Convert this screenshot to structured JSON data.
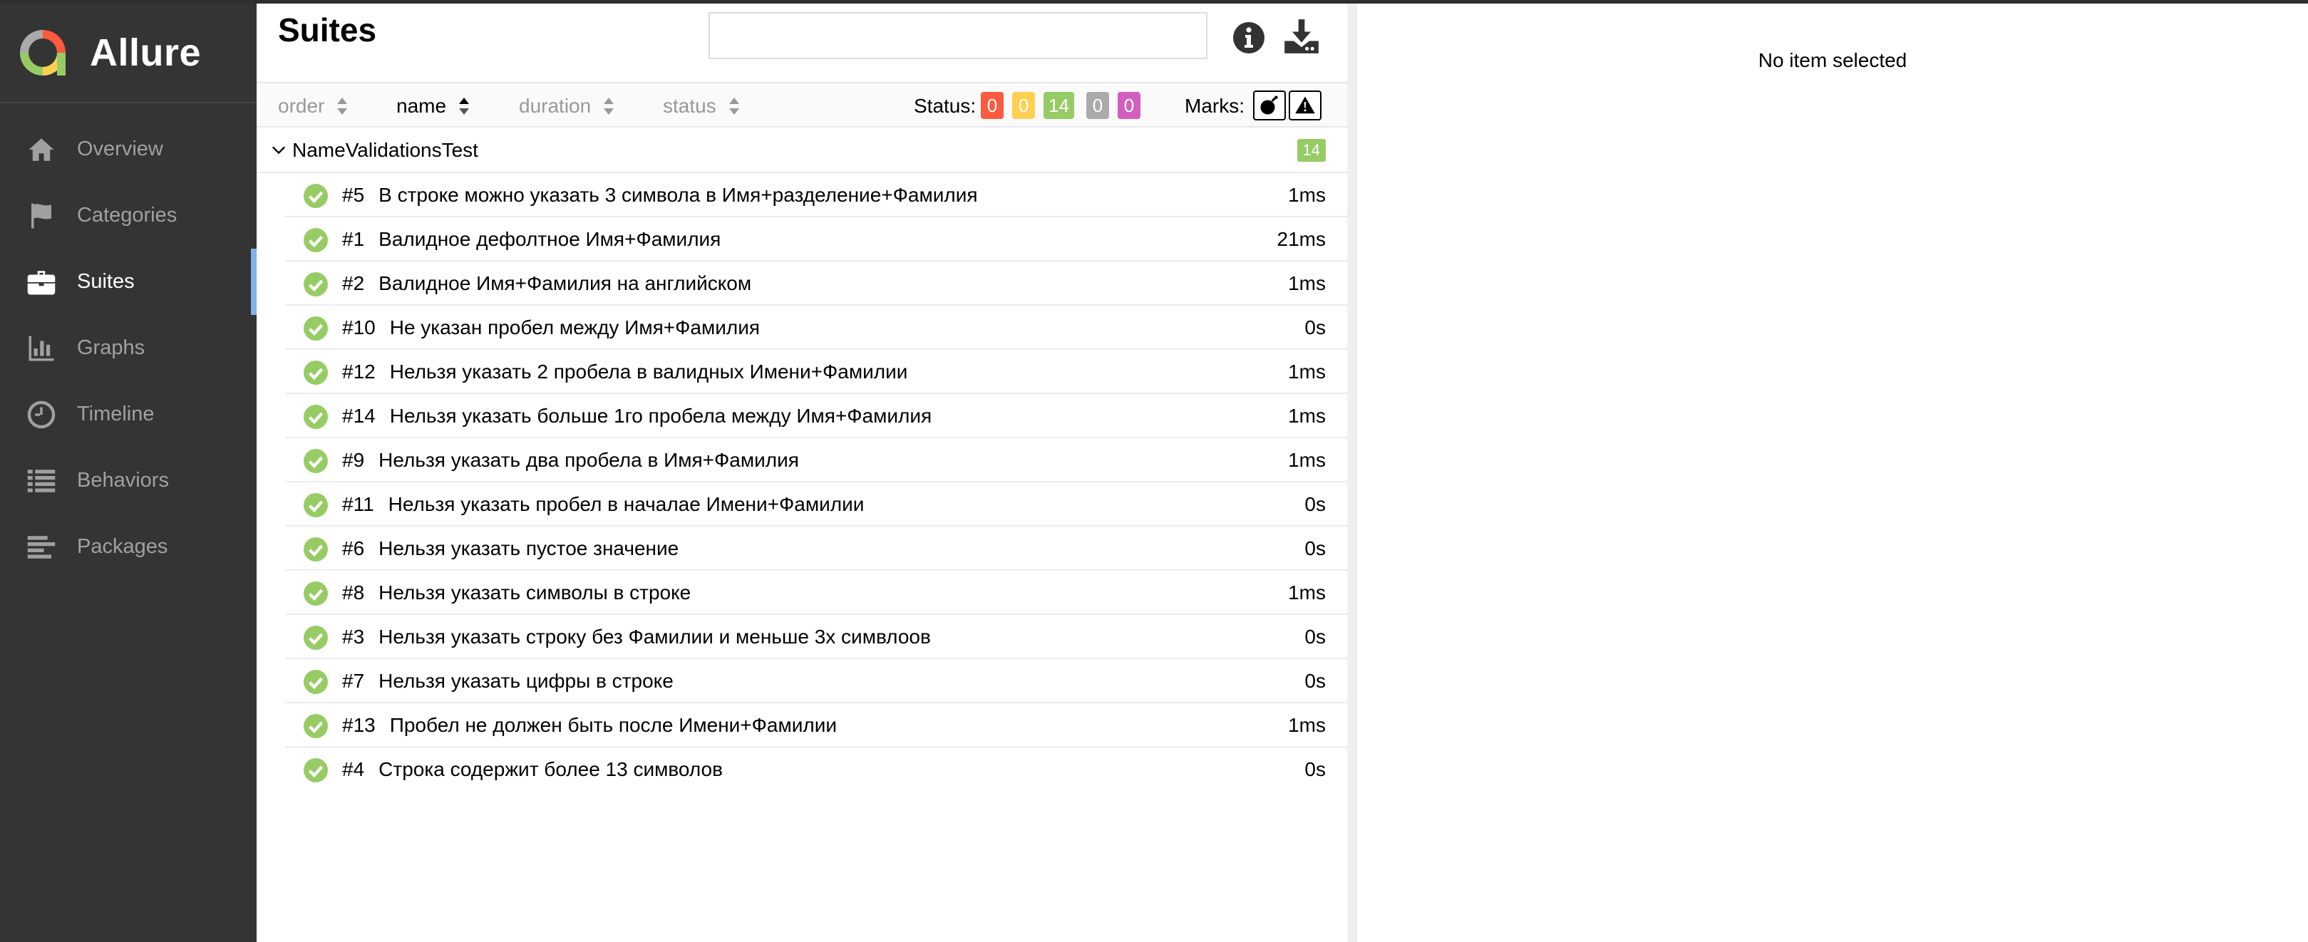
{
  "app": {
    "name": "Allure"
  },
  "sidebar": {
    "items": [
      {
        "label": "Overview",
        "icon": "home-icon"
      },
      {
        "label": "Categories",
        "icon": "flag-icon"
      },
      {
        "label": "Suites",
        "icon": "briefcase-icon",
        "active": true
      },
      {
        "label": "Graphs",
        "icon": "bar-chart-icon"
      },
      {
        "label": "Timeline",
        "icon": "clock-icon"
      },
      {
        "label": "Behaviors",
        "icon": "list-icon"
      },
      {
        "label": "Packages",
        "icon": "align-left-icon"
      }
    ]
  },
  "main": {
    "title": "Suites",
    "search": {
      "value": "",
      "placeholder": ""
    },
    "sorters": {
      "order": "order",
      "name": "name",
      "duration": "duration",
      "status": "status"
    },
    "status_label": "Status:",
    "status_counts": {
      "failed": "0",
      "broken": "0",
      "passed": "14",
      "skipped": "0",
      "unknown": "0"
    },
    "status_colors": {
      "failed": "#fd5a3e",
      "broken": "#ffd050",
      "passed": "#97cc64",
      "skipped": "#aaaaaa",
      "unknown": "#d35ebe"
    },
    "marks_label": "Marks:",
    "group": {
      "name": "NameValidationsTest",
      "count": "14"
    },
    "tests": [
      {
        "num": "#5",
        "name": "В строке можно указать 3 символа в Имя+разделение+Фамилия",
        "duration": "1ms"
      },
      {
        "num": "#1",
        "name": "Валидное дефолтное Имя+Фамилия",
        "duration": "21ms"
      },
      {
        "num": "#2",
        "name": "Валидное Имя+Фамилия на английском",
        "duration": "1ms"
      },
      {
        "num": "#10",
        "name": "Не указан пробел между Имя+Фамилия",
        "duration": "0s"
      },
      {
        "num": "#12",
        "name": "Нельзя указать 2 пробела в валидных Имени+Фамилии",
        "duration": "1ms"
      },
      {
        "num": "#14",
        "name": "Нельзя указать больше 1го пробела между Имя+Фамилия",
        "duration": "1ms"
      },
      {
        "num": "#9",
        "name": "Нельзя указать два пробела в Имя+Фамилия",
        "duration": "1ms"
      },
      {
        "num": "#11",
        "name": "Нельзя указать пробел в началае Имени+Фамилии",
        "duration": "0s"
      },
      {
        "num": "#6",
        "name": "Нельзя указать пустое значение",
        "duration": "0s"
      },
      {
        "num": "#8",
        "name": "Нельзя указать символы в строке",
        "duration": "1ms"
      },
      {
        "num": "#3",
        "name": "Нельзя указать строку без Фамилии и меньше 3х симвлоов",
        "duration": "0s"
      },
      {
        "num": "#7",
        "name": "Нельзя указать цифры в строке",
        "duration": "0s"
      },
      {
        "num": "#13",
        "name": "Пробел не должен быть после Имени+Фамилии",
        "duration": "1ms"
      },
      {
        "num": "#4",
        "name": "Строка содержит более 13 символов",
        "duration": "0s"
      }
    ]
  },
  "detail": {
    "empty_text": "No item selected"
  }
}
